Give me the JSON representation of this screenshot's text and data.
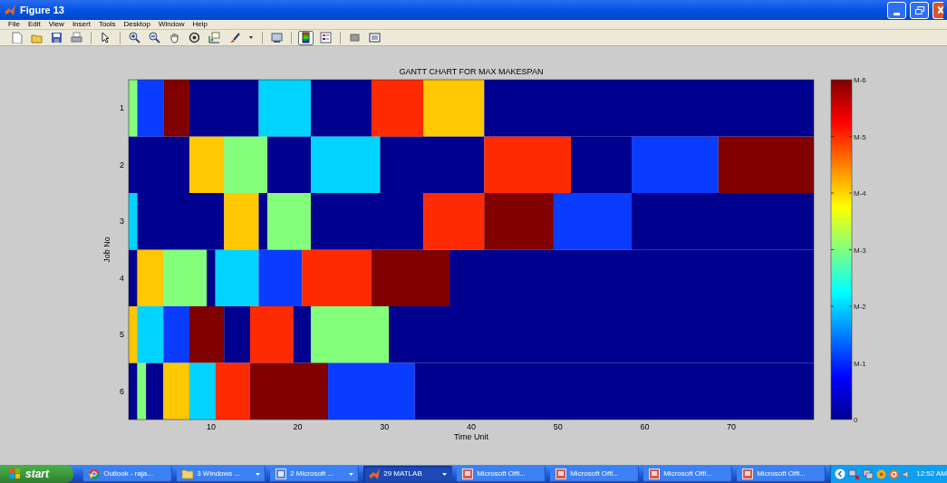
{
  "window": {
    "title": "Figure 13"
  },
  "menu": [
    "File",
    "Edit",
    "View",
    "Insert",
    "Tools",
    "Desktop",
    "Window",
    "Help"
  ],
  "toolbar": [
    {
      "kind": "new",
      "pressed": false
    },
    {
      "kind": "open",
      "pressed": false
    },
    {
      "kind": "save",
      "pressed": false
    },
    {
      "kind": "print",
      "pressed": false
    },
    {
      "kind": "separator"
    },
    {
      "kind": "pointer",
      "pressed": false
    },
    {
      "kind": "separator"
    },
    {
      "kind": "zoom-in",
      "pressed": false
    },
    {
      "kind": "zoom-out",
      "pressed": false
    },
    {
      "kind": "pan",
      "pressed": false
    },
    {
      "kind": "rotate",
      "pressed": false
    },
    {
      "kind": "data-cursor",
      "pressed": false
    },
    {
      "kind": "brush",
      "pressed": false
    },
    {
      "kind": "dropdown",
      "pressed": false
    },
    {
      "kind": "separator"
    },
    {
      "kind": "link",
      "pressed": false
    },
    {
      "kind": "separator"
    },
    {
      "kind": "colorbar",
      "pressed": true
    },
    {
      "kind": "legend",
      "pressed": false
    },
    {
      "kind": "separator"
    },
    {
      "kind": "hide-tools",
      "pressed": false
    },
    {
      "kind": "show-tools",
      "pressed": false
    }
  ],
  "figure": {
    "chart_data": {
      "type": "bar",
      "orientation": "horizontal",
      "stacked": true,
      "title": "GANTT CHART FOR MAX MAKESPAN",
      "xlabel": "Time Unit",
      "ylabel": "Job No",
      "categories": [
        "1",
        "2",
        "3",
        "4",
        "5",
        "6"
      ],
      "xlim": [
        0.5,
        79.5
      ],
      "xticks": [
        10,
        20,
        30,
        40,
        50,
        60,
        70
      ],
      "series": [
        {
          "color": "#00008f",
          "values": [
            null,
            7.5,
            null,
            1.5,
            null,
            1.5
          ]
        },
        {
          "color": "#ffc800",
          "values": [
            null,
            4,
            null,
            3,
            1.5,
            null
          ]
        },
        {
          "color": "#84ff7c",
          "values": [
            1.5,
            5,
            null,
            5,
            null,
            1
          ]
        },
        {
          "color": "#00008f",
          "values": [
            null,
            5,
            null,
            1,
            null,
            2
          ]
        },
        {
          "color": "#00d4ff",
          "values": [
            null,
            8,
            1.5,
            5,
            3,
            null
          ]
        },
        {
          "color": "#0a3cff",
          "values": [
            3,
            null,
            null,
            5,
            3,
            null
          ]
        },
        {
          "color": "#00008f",
          "values": [
            null,
            12,
            10,
            null,
            null,
            null
          ]
        },
        {
          "color": "#ffc800",
          "values": [
            null,
            null,
            4,
            null,
            null,
            3
          ]
        },
        {
          "color": "#800000",
          "values": [
            3,
            null,
            null,
            null,
            4,
            null
          ]
        },
        {
          "color": "#00008f",
          "values": [
            8,
            null,
            1,
            null,
            3,
            null
          ]
        },
        {
          "color": "#ff2a00",
          "values": [
            null,
            10,
            null,
            8,
            5,
            null
          ]
        },
        {
          "color": "#00d4ff",
          "values": [
            6,
            null,
            null,
            null,
            null,
            3
          ]
        },
        {
          "color": "#00008f",
          "values": [
            7,
            7,
            null,
            null,
            2,
            null
          ]
        },
        {
          "color": "#84ff7c",
          "values": [
            null,
            null,
            5,
            null,
            9,
            null
          ]
        },
        {
          "color": "#ff2a00",
          "values": [
            6,
            null,
            null,
            null,
            null,
            4
          ]
        },
        {
          "color": "#800000",
          "values": [
            null,
            null,
            null,
            9,
            null,
            9
          ]
        },
        {
          "color": "#00008f",
          "values": [
            null,
            null,
            13,
            42,
            49,
            null
          ]
        },
        {
          "color": "#0a3cff",
          "values": [
            null,
            10,
            null,
            null,
            null,
            10
          ]
        },
        {
          "color": "#ffc800",
          "values": [
            7,
            null,
            null,
            null,
            null,
            null
          ]
        },
        {
          "color": "#ff2a00",
          "values": [
            null,
            null,
            7,
            null,
            null,
            null
          ]
        },
        {
          "color": "#800000",
          "values": [
            null,
            11,
            8,
            null,
            null,
            null
          ]
        },
        {
          "color": "#0a3cff",
          "values": [
            null,
            null,
            9,
            null,
            null,
            null
          ]
        },
        {
          "color": "#00008f",
          "values": [
            38,
            null,
            21,
            null,
            null,
            46
          ]
        }
      ]
    },
    "colorbar": {
      "ticks": [
        "M-6",
        "M-5",
        "M-4",
        "M-3",
        "M-2",
        "M-1",
        "0"
      ]
    }
  },
  "taskbar": {
    "start": "start",
    "items": [
      {
        "kind": "browser",
        "label": "Outlook - raja...",
        "selected": false,
        "has_menu": false
      },
      {
        "kind": "folder",
        "label": "3 Windows ...",
        "selected": false,
        "has_menu": true
      },
      {
        "kind": "word",
        "label": "2 Microsoft ...",
        "selected": false,
        "has_menu": true
      },
      {
        "kind": "matlab",
        "label": "29 MATLAB",
        "selected": true,
        "has_menu": true
      },
      {
        "kind": "office",
        "label": "Microsoft Offi...",
        "selected": false,
        "has_menu": false
      },
      {
        "kind": "office",
        "label": "Microsoft Offi...",
        "selected": false,
        "has_menu": false
      },
      {
        "kind": "office",
        "label": "Microsoft Offi...",
        "selected": false,
        "has_menu": false
      },
      {
        "kind": "office",
        "label": "Microsoft Offi...",
        "selected": false,
        "has_menu": false
      }
    ],
    "clock": "12:52 AM"
  }
}
